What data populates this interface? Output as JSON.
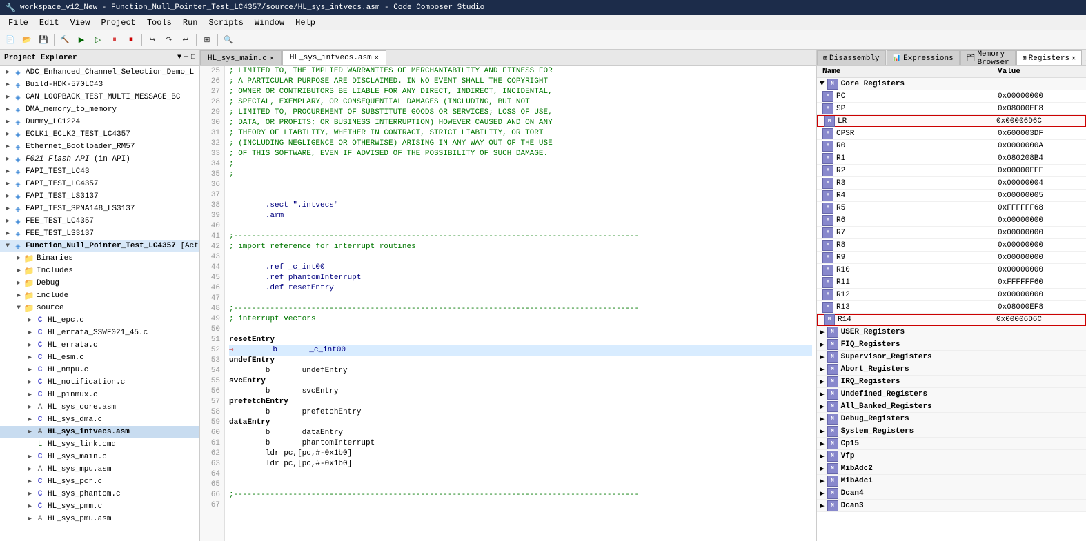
{
  "window": {
    "title": "workspace_v12_New - Function_Null_Pointer_Test_LC4357/source/HL_sys_intvecs.asm - Code Composer Studio"
  },
  "menu": {
    "items": [
      "File",
      "Edit",
      "View",
      "Project",
      "Tools",
      "Run",
      "Scripts",
      "Window",
      "Help"
    ]
  },
  "project_explorer": {
    "tab_label": "Project Explorer",
    "projects": [
      {
        "name": "ADC_Enhanced_Channel_Selection_Demo_L",
        "type": "project",
        "expanded": false
      },
      {
        "name": "Build-HDK-570LC43",
        "type": "project",
        "expanded": false
      },
      {
        "name": "CAN_LOOPBACK_TEST_MULTI_MESSAGE_BC",
        "type": "project",
        "expanded": false
      },
      {
        "name": "DMA_memory_to_memory",
        "type": "project",
        "expanded": false
      },
      {
        "name": "Dummy_LC1224",
        "type": "project",
        "expanded": false
      },
      {
        "name": "ECLK1_ECLK2_TEST_LC4357",
        "type": "project",
        "expanded": false
      },
      {
        "name": "Ethernet_Bootloader_RM57",
        "type": "project",
        "expanded": false
      },
      {
        "name": "F021 Flash API (in API)",
        "type": "project",
        "expanded": false,
        "italic": true
      },
      {
        "name": "FAPI_TEST_LC43",
        "type": "project",
        "expanded": false
      },
      {
        "name": "FAPI_TEST_LC4357",
        "type": "project",
        "expanded": false
      },
      {
        "name": "FAPI_TEST_LS3137",
        "type": "project",
        "expanded": false
      },
      {
        "name": "FAPI_TEST_SPNA148_LS3137",
        "type": "project",
        "expanded": false
      },
      {
        "name": "FEE_TEST_LC4357",
        "type": "project",
        "expanded": false
      },
      {
        "name": "FEE_TEST_LS3137",
        "type": "project",
        "expanded": false
      },
      {
        "name": "Function_Null_Pointer_Test_LC4357",
        "type": "project",
        "expanded": true,
        "active": true,
        "suffix": " [Acti"
      }
    ],
    "function_null_children": [
      {
        "name": "Binaries",
        "type": "folder",
        "indent": 1,
        "expanded": false
      },
      {
        "name": "Includes",
        "type": "folder",
        "indent": 1,
        "expanded": false
      },
      {
        "name": "Debug",
        "type": "folder",
        "indent": 1,
        "expanded": false
      },
      {
        "name": "include",
        "type": "folder",
        "indent": 1,
        "expanded": false
      },
      {
        "name": "source",
        "type": "folder",
        "indent": 1,
        "expanded": true
      }
    ],
    "source_files": [
      {
        "name": "HL_epc.c",
        "type": "c"
      },
      {
        "name": "HL_errata_SSWF021_45.c",
        "type": "c"
      },
      {
        "name": "HL_errata.c",
        "type": "c"
      },
      {
        "name": "HL_esm.c",
        "type": "c"
      },
      {
        "name": "HL_nmpu.c",
        "type": "c"
      },
      {
        "name": "HL_notification.c",
        "type": "c"
      },
      {
        "name": "HL_pinmux.c",
        "type": "c"
      },
      {
        "name": "HL_sys_core.asm",
        "type": "asm"
      },
      {
        "name": "HL_sys_dma.c",
        "type": "c"
      },
      {
        "name": "HL_sys_intvecs.asm",
        "type": "asm",
        "selected": true
      },
      {
        "name": "HL_sys_link.cmd",
        "type": "cmd"
      },
      {
        "name": "HL_sys_main.c",
        "type": "c"
      },
      {
        "name": "HL_sys_mpu.asm",
        "type": "asm"
      },
      {
        "name": "HL_sys_pcr.c",
        "type": "c"
      },
      {
        "name": "HL_sys_phantom.c",
        "type": "c"
      },
      {
        "name": "HL_sys_pmm.c",
        "type": "c"
      },
      {
        "name": "HL_sys_pmu.asm",
        "type": "asm"
      }
    ]
  },
  "editor": {
    "tabs": [
      {
        "label": "HL_sys_main.c",
        "active": false
      },
      {
        "label": "HL_sys_intvecs.asm",
        "active": true
      }
    ],
    "lines": [
      {
        "num": 25,
        "content": "; LIMITED TO, THE IMPLIED WARRANTIES OF MERCHANTABILITY AND FITNESS FOR",
        "type": "comment"
      },
      {
        "num": 26,
        "content": "; A PARTICULAR PURPOSE ARE DISCLAIMED. IN NO EVENT SHALL THE COPYRIGHT",
        "type": "comment"
      },
      {
        "num": 27,
        "content": "; OWNER OR CONTRIBUTORS BE LIABLE FOR ANY DIRECT, INDIRECT, INCIDENTAL,",
        "type": "comment"
      },
      {
        "num": 28,
        "content": "; SPECIAL, EXEMPLARY, OR CONSEQUENTIAL DAMAGES (INCLUDING, BUT NOT",
        "type": "comment"
      },
      {
        "num": 29,
        "content": "; LIMITED TO, PROCUREMENT OF SUBSTITUTE GOODS OR SERVICES; LOSS OF USE,",
        "type": "comment"
      },
      {
        "num": 30,
        "content": "; DATA, OR PROFITS; OR BUSINESS INTERRUPTION) HOWEVER CAUSED AND ON ANY",
        "type": "comment"
      },
      {
        "num": 31,
        "content": "; THEORY OF LIABILITY, WHETHER IN CONTRACT, STRICT LIABILITY, OR TORT",
        "type": "comment"
      },
      {
        "num": 32,
        "content": "; (INCLUDING NEGLIGENCE OR OTHERWISE) ARISING IN ANY WAY OUT OF THE USE",
        "type": "comment"
      },
      {
        "num": 33,
        "content": "; OF THIS SOFTWARE, EVEN IF ADVISED OF THE POSSIBILITY OF SUCH DAMAGE.",
        "type": "comment"
      },
      {
        "num": 34,
        "content": ";",
        "type": "comment"
      },
      {
        "num": 35,
        "content": ";",
        "type": "comment"
      },
      {
        "num": 36,
        "content": "",
        "type": "normal"
      },
      {
        "num": 37,
        "content": "",
        "type": "normal"
      },
      {
        "num": 38,
        "content": "        .sect \".intvecs\"",
        "type": "directive"
      },
      {
        "num": 39,
        "content": "        .arm",
        "type": "directive"
      },
      {
        "num": 40,
        "content": "",
        "type": "normal"
      },
      {
        "num": 41,
        "content": ";-----------------------------------------------------------------------------------------",
        "type": "dashed"
      },
      {
        "num": 42,
        "content": "; import reference for interrupt routines",
        "type": "comment"
      },
      {
        "num": 43,
        "content": "",
        "type": "normal"
      },
      {
        "num": 44,
        "content": "        .ref _c_int00",
        "type": "directive"
      },
      {
        "num": 45,
        "content": "        .ref phantomInterrupt",
        "type": "directive"
      },
      {
        "num": 46,
        "content": "        .def resetEntry",
        "type": "directive"
      },
      {
        "num": 47,
        "content": "",
        "type": "normal"
      },
      {
        "num": 48,
        "content": ";-----------------------------------------------------------------------------------------",
        "type": "dashed"
      },
      {
        "num": 49,
        "content": "; interrupt vectors",
        "type": "comment"
      },
      {
        "num": 50,
        "content": "",
        "type": "normal"
      },
      {
        "num": 51,
        "content": "resetEntry",
        "type": "label"
      },
      {
        "num": 52,
        "content": "        b       _c_int00",
        "type": "highlighted"
      },
      {
        "num": 53,
        "content": "undefEntry",
        "type": "label"
      },
      {
        "num": 54,
        "content": "        b       undefEntry",
        "type": "normal"
      },
      {
        "num": 55,
        "content": "svcEntry",
        "type": "label"
      },
      {
        "num": 56,
        "content": "        b       svcEntry",
        "type": "normal"
      },
      {
        "num": 57,
        "content": "prefetchEntry",
        "type": "label"
      },
      {
        "num": 58,
        "content": "        b       prefetchEntry",
        "type": "normal"
      },
      {
        "num": 59,
        "content": "dataEntry",
        "type": "label"
      },
      {
        "num": 60,
        "content": "        b       dataEntry",
        "type": "normal"
      },
      {
        "num": 61,
        "content": "        b       phantomInterrupt",
        "type": "normal"
      },
      {
        "num": 62,
        "content": "        ldr pc,[pc,#-0x1b0]",
        "type": "normal"
      },
      {
        "num": 63,
        "content": "        ldr pc,[pc,#-0x1b0]",
        "type": "normal"
      },
      {
        "num": 64,
        "content": "",
        "type": "normal"
      },
      {
        "num": 65,
        "content": "",
        "type": "normal"
      },
      {
        "num": 66,
        "content": ";-----------------------------------------------------------------------------------------",
        "type": "dashed"
      },
      {
        "num": 67,
        "content": "",
        "type": "normal"
      }
    ]
  },
  "right_panel": {
    "tabs": [
      {
        "label": "Disassembly",
        "icon": "disassembly"
      },
      {
        "label": "Expressions",
        "icon": "expressions"
      },
      {
        "label": "Memory Browser",
        "icon": "memory"
      },
      {
        "label": "Registers",
        "icon": "registers",
        "active": true
      }
    ],
    "columns": {
      "name": "Name",
      "value": "Value"
    },
    "core_registers": {
      "group_label": "Core Registers",
      "registers": [
        {
          "name": "PC",
          "value": "0x00000000",
          "highlighted": false
        },
        {
          "name": "SP",
          "value": "0x08000EF8",
          "highlighted": false
        },
        {
          "name": "LR",
          "value": "0x00006D6C",
          "highlighted": true
        },
        {
          "name": "CPSR",
          "value": "0x600003DF",
          "highlighted": false
        },
        {
          "name": "R0",
          "value": "0x0000000A",
          "highlighted": false
        },
        {
          "name": "R1",
          "value": "0x080208B4",
          "highlighted": false
        },
        {
          "name": "R2",
          "value": "0x00000FFF",
          "highlighted": false
        },
        {
          "name": "R3",
          "value": "0x00000004",
          "highlighted": false
        },
        {
          "name": "R4",
          "value": "0x00000005",
          "highlighted": false
        },
        {
          "name": "R5",
          "value": "0xFFFFFF68",
          "highlighted": false
        },
        {
          "name": "R6",
          "value": "0x00000000",
          "highlighted": false
        },
        {
          "name": "R7",
          "value": "0x00000000",
          "highlighted": false
        },
        {
          "name": "R8",
          "value": "0x00000000",
          "highlighted": false
        },
        {
          "name": "R9",
          "value": "0x00000000",
          "highlighted": false
        },
        {
          "name": "R10",
          "value": "0x00000000",
          "highlighted": false
        },
        {
          "name": "R11",
          "value": "0xFFFFFF60",
          "highlighted": false
        },
        {
          "name": "R12",
          "value": "0x00000000",
          "highlighted": false
        },
        {
          "name": "R13",
          "value": "0x08000EF8",
          "highlighted": false
        },
        {
          "name": "R14",
          "value": "0x00006D6C",
          "highlighted": true
        }
      ]
    },
    "register_groups": [
      {
        "name": "USER_Registers",
        "expanded": false
      },
      {
        "name": "FIQ_Registers",
        "expanded": false
      },
      {
        "name": "Supervisor_Registers",
        "expanded": false
      },
      {
        "name": "Abort_Registers",
        "expanded": false
      },
      {
        "name": "IRQ_Registers",
        "expanded": false
      },
      {
        "name": "Undefined_Registers",
        "expanded": false
      },
      {
        "name": "All_Banked_Registers",
        "expanded": false
      },
      {
        "name": "Debug_Registers",
        "expanded": false
      },
      {
        "name": "System_Registers",
        "expanded": false
      },
      {
        "name": "Cp15",
        "expanded": false
      },
      {
        "name": "Vfp",
        "expanded": false
      },
      {
        "name": "MibAdc2",
        "expanded": false
      },
      {
        "name": "MibAdc1",
        "expanded": false
      },
      {
        "name": "Dcan4",
        "expanded": false
      },
      {
        "name": "Dcan3",
        "expanded": false
      }
    ]
  }
}
